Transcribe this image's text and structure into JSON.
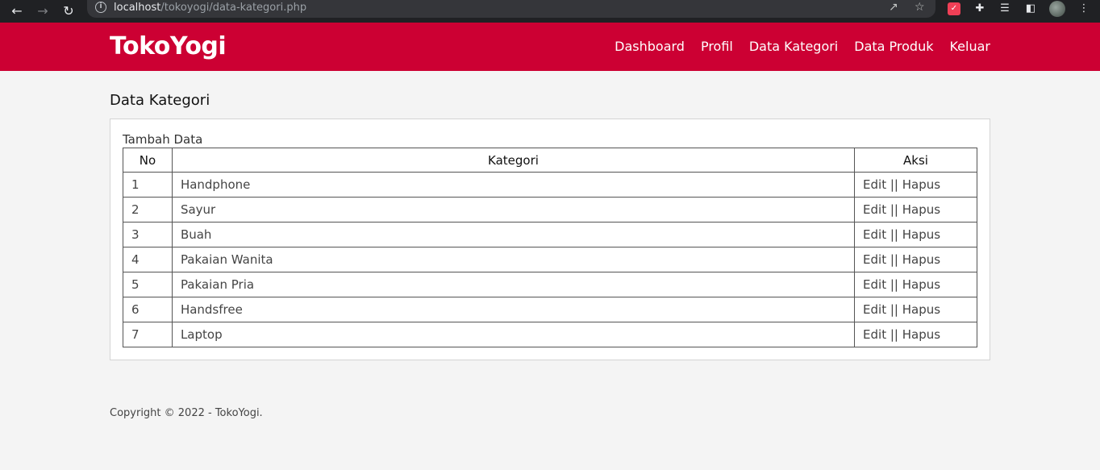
{
  "browser": {
    "url_host": "localhost",
    "url_path": "/tokoyogi/data-kategori.php"
  },
  "header": {
    "brand": "TokoYogi",
    "menu": [
      "Dashboard",
      "Profil",
      "Data Kategori",
      "Data Produk",
      "Keluar"
    ]
  },
  "main": {
    "title": "Data Kategori",
    "add_label": "Tambah Data",
    "table": {
      "headers": [
        "No",
        "Kategori",
        "Aksi"
      ],
      "rows": [
        {
          "no": "1",
          "kategori": "Handphone"
        },
        {
          "no": "2",
          "kategori": "Sayur"
        },
        {
          "no": "3",
          "kategori": "Buah"
        },
        {
          "no": "4",
          "kategori": "Pakaian Wanita"
        },
        {
          "no": "5",
          "kategori": "Pakaian Pria"
        },
        {
          "no": "6",
          "kategori": "Handsfree"
        },
        {
          "no": "7",
          "kategori": "Laptop"
        }
      ],
      "edit_label": "Edit",
      "separator": "||",
      "delete_label": "Hapus"
    }
  },
  "footer": {
    "copyright": "Copyright © 2022 - TokoYogi."
  },
  "colors": {
    "brand": "#cc0033",
    "background": "#f4f4f4"
  },
  "icons": [
    "back-arrow-icon",
    "forward-arrow-icon",
    "reload-icon",
    "info-icon",
    "share-icon",
    "star-icon",
    "pocket-icon",
    "puzzle-icon",
    "media-icon",
    "side-panel-icon",
    "avatar",
    "kebab-menu-icon"
  ]
}
